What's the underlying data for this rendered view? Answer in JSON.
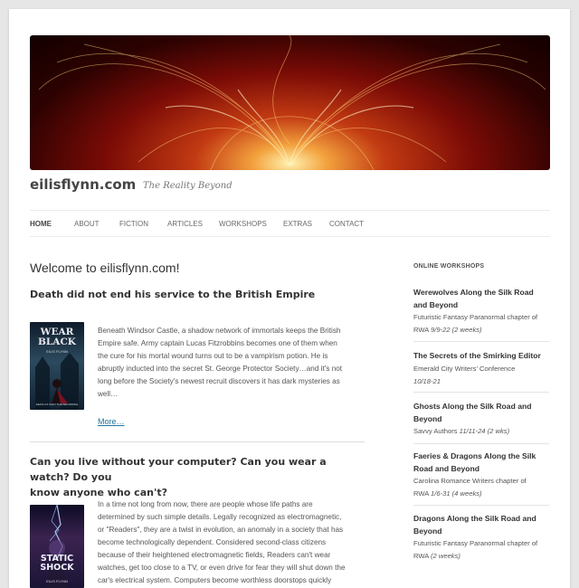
{
  "site": {
    "title": "eilisflynn.com",
    "tagline": "The Reality Beyond"
  },
  "nav": {
    "items": [
      "HOME",
      "ABOUT",
      "FICTION",
      "ARTICLES",
      "WORKSHOPS",
      "EXTRAS",
      "CONTACT"
    ],
    "active": "HOME"
  },
  "main": {
    "welcome": "Welcome to eilisflynn.com!",
    "posts": [
      {
        "title": "Death did not end his service to the British Empire",
        "lines": [
          "Beneath Windsor Castle, a shadow network of immortals keeps the British",
          "Empire safe. Army captain Lucas Fitzrobbins becomes one of them when",
          "the cure for his mortal wound turns out to be a vampirism potion. He is",
          "abruptly inducted into the secret St. George Protector Society…and it's not",
          "long before the Society's newest recruit discovers it has dark mysteries as",
          "well…"
        ],
        "more": "More…",
        "cover": {
          "title": "WEAR BLACK",
          "author": "EILIS FLYNN",
          "caption": "DEATH IS ONLY THE BEGINNING"
        }
      },
      {
        "title_lines": [
          "Can you live without your computer? Can you wear a watch? Do you",
          "know anyone who can't?"
        ],
        "lines": [
          "In a time not long from now, there are people whose life paths are",
          "determined by such simple details. Legally recognized as electromagnetic,",
          "or \"Readers\", they are a twist in evolution, an anomaly in a society that has",
          "become technologically dependent. Considered second-class citizens",
          "because of their heightened electromagnetic fields, Readers can't wear",
          "watches, get too close to a TV, or even drive for fear they will shut down the",
          "car's electrical system. Computers become worthless doorstops quickly"
        ],
        "cover": {
          "title": "STATIC SHOCK",
          "author": "EILIS FLYNN"
        }
      }
    ]
  },
  "sidebar": {
    "widget_title": "ONLINE WORKSHOPS",
    "workshops": [
      {
        "title_lines": [
          "Werewolves Along the Silk Road",
          "and Beyond"
        ],
        "desc_lines": [
          "Futuristic Fantasy Paranormal chapter of"
        ],
        "desc_end": "RWA",
        "dates": "9/9-22 (2 weeks)"
      },
      {
        "title_lines": [
          "The Secrets of the Smirking Editor"
        ],
        "desc_lines": [
          "Emerald City Writers' Conference"
        ],
        "desc_end": "",
        "dates": "10/18-21"
      },
      {
        "title_lines": [
          "Ghosts Along the Silk Road and",
          "Beyond"
        ],
        "desc_lines": [],
        "desc_end": "Savvy Authors",
        "dates": "11/11-24 (2 wks)"
      },
      {
        "title_lines": [
          "Faeries & Dragons Along the Silk",
          "Road and Beyond"
        ],
        "desc_lines": [
          "Carolina Romance Writers chapter of"
        ],
        "desc_end": "RWA",
        "dates": "1/6-31 (4 weeks)"
      },
      {
        "title_lines": [
          "Dragons Along the Silk Road and",
          "Beyond"
        ],
        "desc_lines": [
          "Futuristic Fantasy Paranormal chapter of"
        ],
        "desc_end": "RWA",
        "dates": "(2 weeks)"
      }
    ]
  },
  "colors": {
    "link": "#21759b",
    "banner_dark": "#2c0201",
    "banner_glow": "#f3a23e"
  }
}
